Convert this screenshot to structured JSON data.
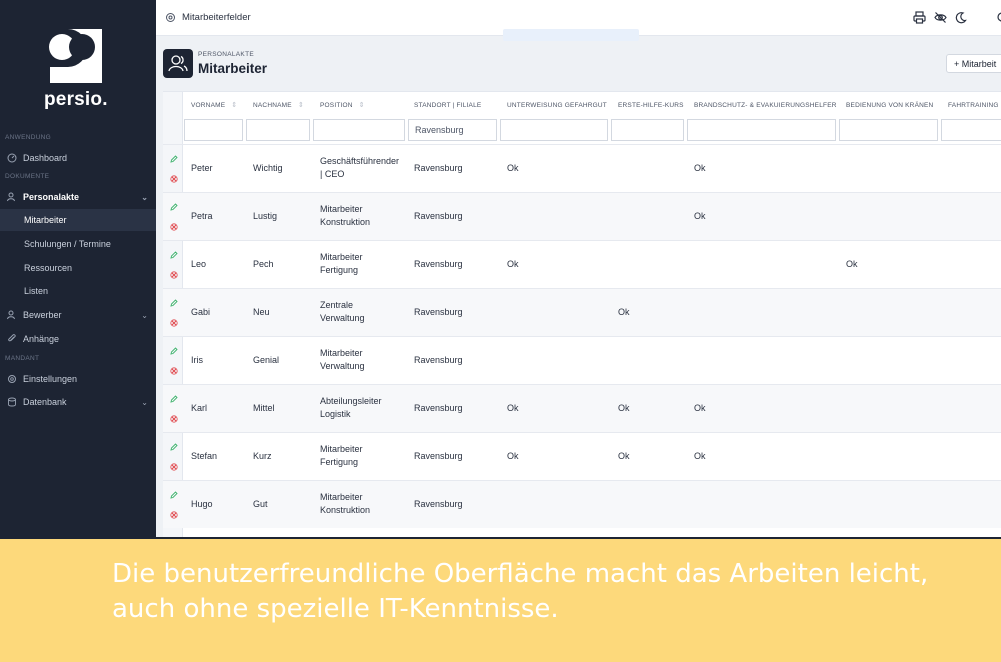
{
  "brand": {
    "name": "persio."
  },
  "sidebar": {
    "sections": {
      "anwendung": "ANWENDUNG",
      "dokumente": "DOKUMENTE",
      "mandant": "MANDANT"
    },
    "items": {
      "dashboard": "Dashboard",
      "personalakte": "Personalakte",
      "mitarbeiter": "Mitarbeiter",
      "schulungen": "Schulungen / Termine",
      "ressourcen": "Ressourcen",
      "listen": "Listen",
      "bewerber": "Bewerber",
      "anhaenge": "Anhänge",
      "einstellungen": "Einstellungen",
      "datenbank": "Datenbank"
    }
  },
  "topbar": {
    "title": "Mitarbeiterfelder"
  },
  "page_header": {
    "eyebrow": "PERSONALAKTE",
    "title": "Mitarbeiter",
    "add_button": "+ Mitarbeit"
  },
  "table": {
    "columns": [
      "VORNAME",
      "NACHNAME",
      "POSITION",
      "STANDORT | FILIALE",
      "UNTERWEISUNG GEFAHRGUT",
      "ERSTE-HILFE-KURS",
      "BRANDSCHUTZ- & EVAKUIERUNGSHELFER",
      "BEDIENUNG VON KRÄNEN",
      "FAHRTRAINING"
    ],
    "filters": {
      "standort": "Ravensburg"
    },
    "rows": [
      {
        "vorname": "Peter",
        "nachname": "Wichtig",
        "position_1": "Geschäftsführender",
        "position_2": "| CEO",
        "standort": "Ravensburg",
        "gefahrgut": "Ok",
        "erste_hilfe": "",
        "brandschutz": "Ok",
        "kraene": ""
      },
      {
        "vorname": "Petra",
        "nachname": "Lustig",
        "position_1": "Mitarbeiter",
        "position_2": "Konstruktion",
        "standort": "Ravensburg",
        "gefahrgut": "",
        "erste_hilfe": "",
        "brandschutz": "Ok",
        "kraene": ""
      },
      {
        "vorname": "Leo",
        "nachname": "Pech",
        "position_1": "Mitarbeiter",
        "position_2": "Fertigung",
        "standort": "Ravensburg",
        "gefahrgut": "Ok",
        "erste_hilfe": "",
        "brandschutz": "",
        "kraene": "Ok"
      },
      {
        "vorname": "Gabi",
        "nachname": "Neu",
        "position_1": "Zentrale",
        "position_2": "Verwaltung",
        "standort": "Ravensburg",
        "gefahrgut": "",
        "erste_hilfe": "Ok",
        "brandschutz": "",
        "kraene": ""
      },
      {
        "vorname": "Iris",
        "nachname": "Genial",
        "position_1": "Mitarbeiter",
        "position_2": "Verwaltung",
        "standort": "Ravensburg",
        "gefahrgut": "",
        "erste_hilfe": "",
        "brandschutz": "",
        "kraene": ""
      },
      {
        "vorname": "Karl",
        "nachname": "Mittel",
        "position_1": "Abteilungsleiter",
        "position_2": "Logistik",
        "standort": "Ravensburg",
        "gefahrgut": "Ok",
        "erste_hilfe": "Ok",
        "brandschutz": "Ok",
        "kraene": ""
      },
      {
        "vorname": "Stefan",
        "nachname": "Kurz",
        "position_1": "Mitarbeiter",
        "position_2": "Fertigung",
        "standort": "Ravensburg",
        "gefahrgut": "Ok",
        "erste_hilfe": "Ok",
        "brandschutz": "Ok",
        "kraene": ""
      },
      {
        "vorname": "Hugo",
        "nachname": "Gut",
        "position_1": "Mitarbeiter",
        "position_2": "Konstruktion",
        "standort": "Ravensburg",
        "gefahrgut": "",
        "erste_hilfe": "",
        "brandschutz": "",
        "kraene": ""
      }
    ]
  },
  "caption": {
    "line1": "Die benutzerfreundliche Oberfläche macht das Arbeiten leicht,",
    "line2": "auch ohne spezielle IT-Kenntnisse."
  },
  "colors": {
    "sidebar": "#1d2433",
    "banner": "#fdd97b",
    "edit_icon": "#3bb26a",
    "delete_icon": "#e0464b"
  }
}
